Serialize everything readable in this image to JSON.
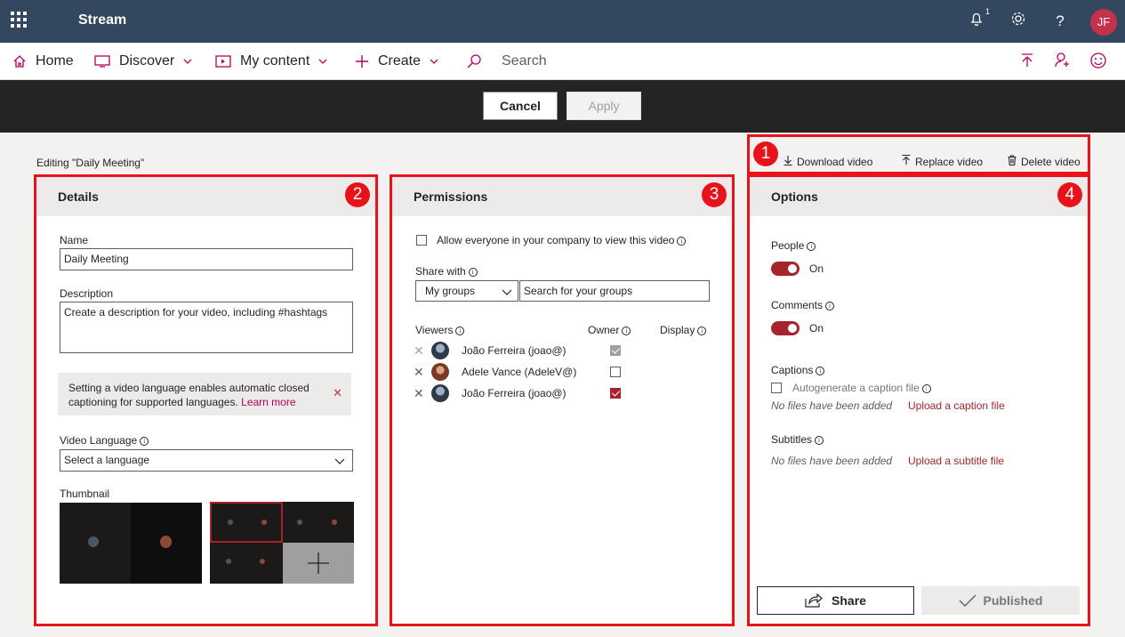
{
  "app": {
    "name": "Stream",
    "notification_count": "1",
    "user_initials": "JF"
  },
  "nav": {
    "home": "Home",
    "discover": "Discover",
    "my_content": "My content",
    "create": "Create",
    "search_placeholder": "Search"
  },
  "actions": {
    "cancel": "Cancel",
    "apply": "Apply"
  },
  "editing_label": "Editing \"Daily Meeting\"",
  "video_actions": {
    "download": "Download video",
    "replace": "Replace video",
    "delete": "Delete video"
  },
  "markers": [
    "1",
    "2",
    "3",
    "4"
  ],
  "details": {
    "title": "Details",
    "name_label": "Name",
    "name_value": "Daily Meeting",
    "description_label": "Description",
    "description_placeholder": "Create a description for your video, including #hashtags",
    "notice_text": "Setting a video language enables automatic closed captioning for supported languages.",
    "notice_link": "Learn more",
    "language_label": "Video Language",
    "language_value": "Select a language",
    "thumbnail_label": "Thumbnail"
  },
  "permissions": {
    "title": "Permissions",
    "allow_everyone": "Allow everyone in your company to view this video",
    "share_with_label": "Share with",
    "share_with_value": "My groups",
    "search_groups_placeholder": "Search for your groups",
    "columns": {
      "viewers": "Viewers",
      "owner": "Owner",
      "display": "Display"
    },
    "viewers": [
      {
        "name": "João Ferreira (joao@)",
        "owner": "grey"
      },
      {
        "name": "Adele Vance (AdeleV@)",
        "owner": "unchecked"
      },
      {
        "name": "João Ferreira (joao@)",
        "owner": "checked"
      }
    ]
  },
  "options": {
    "title": "Options",
    "people_label": "People",
    "people_state": "On",
    "comments_label": "Comments",
    "comments_state": "On",
    "captions_label": "Captions",
    "autogenerate_label": "Autogenerate a caption file",
    "captions_none": "No files have been added",
    "upload_caption": "Upload a caption file",
    "subtitles_label": "Subtitles",
    "subtitles_none": "No files have been added",
    "upload_subtitle": "Upload a subtitle file",
    "share": "Share",
    "published": "Published"
  },
  "colors": {
    "accent": "#b4005a",
    "annotation_red": "#e8121a",
    "topbar": "#33475f",
    "toggle": "#a4262c"
  }
}
